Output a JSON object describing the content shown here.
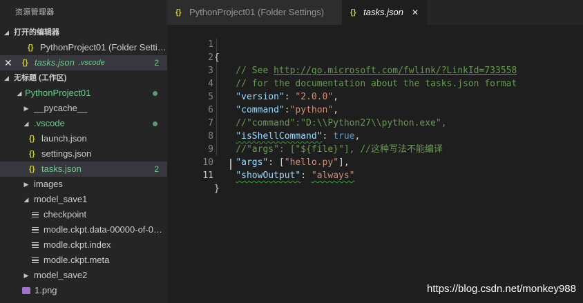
{
  "sidebar": {
    "title": "资源管理器",
    "open_editors": {
      "header": "打开的编辑器",
      "items": [
        {
          "name": "PythonProject01 (Folder Setti…"
        },
        {
          "name": "tasks.json",
          "folder": ".vscode",
          "badge": "2"
        }
      ]
    },
    "workspace": {
      "header": "无标题 (工作区)",
      "root": "PythonProject01",
      "items": [
        {
          "name": "__pycache__"
        },
        {
          "name": ".vscode"
        },
        {
          "name": "launch.json"
        },
        {
          "name": "settings.json"
        },
        {
          "name": "tasks.json",
          "badge": "2"
        },
        {
          "name": "images"
        },
        {
          "name": "model_save1"
        },
        {
          "name": "checkpoint"
        },
        {
          "name": "modle.ckpt.data-00000-of-00…"
        },
        {
          "name": "modle.ckpt.index"
        },
        {
          "name": "modle.ckpt.meta"
        },
        {
          "name": "model_save2"
        },
        {
          "name": "1.png"
        }
      ]
    }
  },
  "tabs": [
    {
      "label": "PythonProject01 (Folder Settings)",
      "icon": "json-braces-icon"
    },
    {
      "label": "tasks.json",
      "icon": "json-braces-icon",
      "active": true
    }
  ],
  "editor": {
    "line_numbers": [
      "1",
      "2",
      "3",
      "4",
      "5",
      "6",
      "7",
      "8",
      "9",
      "10",
      "11"
    ],
    "current_line": "11",
    "lines": {
      "l1": "{",
      "l2_prefix": "    // See ",
      "l2_link": "http://go.microsoft.com/fwlink/?LinkId=733558",
      "l3": "    // for the documentation about the tasks.json format",
      "l4_key": "\"version\"",
      "l4_val": "\"2.0.0\"",
      "l5_key": "\"command\"",
      "l5_val": "\"python\"",
      "l6": "    //\"command\":\"D:\\\\Python27\\\\python.exe\",",
      "l7_key": "\"isShellCommand\"",
      "l7_val": "true",
      "l8": "    //\"args\": [\"${file}\"], //这种写法不能编译",
      "l9_key": "\"args\"",
      "l9_val": "\"hello.py\"",
      "l10_key": "\"showOutput\"",
      "l10_val": "\"always\"",
      "l11": "}"
    }
  },
  "watermark": "https://blog.csdn.net/monkey988",
  "colors": {
    "sidebar_bg": "#252526",
    "editor_bg": "#1e1e1e",
    "git_modified": "#73c991",
    "json_icon": "#cbcb41",
    "comment": "#6a9955",
    "json_key": "#9cdcfe",
    "string": "#ce9178",
    "keyword": "#569cd6"
  }
}
